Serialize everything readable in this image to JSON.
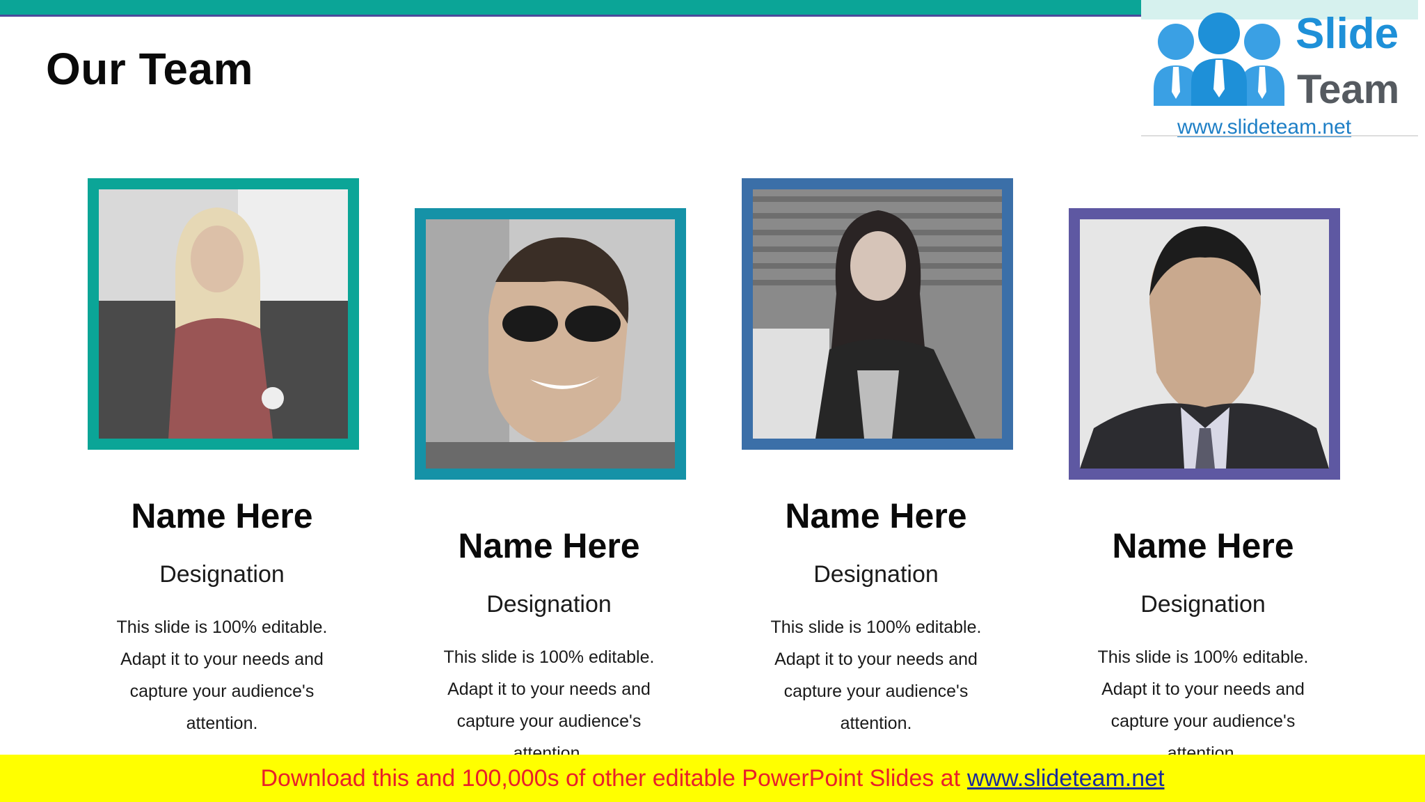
{
  "slide": {
    "title": "Our Team"
  },
  "logo": {
    "word1": "Slide",
    "word2": "Team",
    "url": "www.slideteam.net"
  },
  "colors": {
    "teal": "#0ba597",
    "ocean": "#1592a7",
    "blue": "#3b6fa8",
    "purple": "#5e58a2",
    "banner": "#ffff00",
    "banner_text": "#e8202a"
  },
  "team": [
    {
      "name": "Name Here",
      "designation": "Designation",
      "desc_lines": [
        "This slide is 100% editable.",
        "Adapt it to your needs and",
        "capture your audience's",
        "attention."
      ]
    },
    {
      "name": "Name Here",
      "designation": "Designation",
      "desc_lines": [
        "This slide is 100% editable.",
        "Adapt it to your needs and",
        "capture your audience's",
        "attention."
      ]
    },
    {
      "name": "Name Here",
      "designation": "Designation",
      "desc_lines": [
        "This slide is 100% editable.",
        "Adapt it to your needs and",
        "capture your audience's",
        "attention."
      ]
    },
    {
      "name": "Name Here",
      "designation": "Designation",
      "desc_lines": [
        "This slide is 100% editable.",
        "Adapt it to your needs and",
        "capture your audience's",
        "attention."
      ]
    }
  ],
  "banner": {
    "text": "Download this and 100,000s of other editable PowerPoint Slides at",
    "link": "www.slideteam.net"
  }
}
